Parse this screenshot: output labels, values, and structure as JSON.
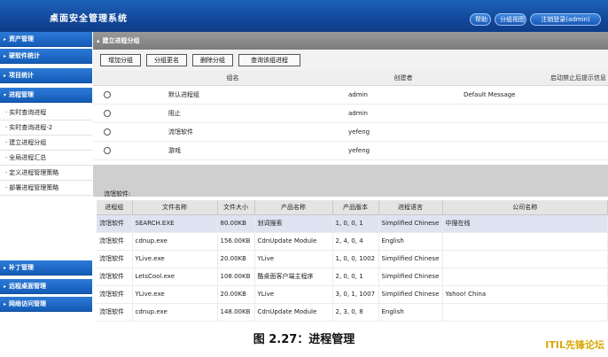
{
  "header": {
    "title": "桌面安全管理系统",
    "buttons": {
      "help": "帮助",
      "group_view": "分组视图",
      "logout": "注销登录(admin)"
    }
  },
  "sidebar": {
    "top_sections": [
      "资产管理",
      "硬软件统计",
      "项目统计",
      "进程管理"
    ],
    "process_items": [
      "实时查询进程",
      "实时查询进程-2",
      "建立进程分组",
      "全局进程汇总",
      "定义进程管理策略",
      "部署进程管理策略"
    ],
    "bottom_sections": [
      "补丁管理",
      "远程桌面管理",
      "网络访问管理"
    ]
  },
  "main": {
    "section_title": "建立进程分组",
    "toolbar": {
      "add": "增加分组",
      "rename": "分组更名",
      "delete": "删除分组",
      "query": "查询该组进程"
    },
    "group_table": {
      "headers": {
        "name": "组名",
        "creator": "创建者",
        "message": "启动禁止后提示信息"
      },
      "rows": [
        {
          "name": "默认进程组",
          "creator": "admin",
          "message": "Default Message"
        },
        {
          "name": "阻止",
          "creator": "admin",
          "message": ""
        },
        {
          "name": "流氓软件",
          "creator": "yefeng",
          "message": ""
        },
        {
          "name": "游戏",
          "creator": "yefeng",
          "message": ""
        }
      ]
    },
    "process_caption": "流氓软件:",
    "process_table": {
      "headers": [
        "进程组",
        "文件名称",
        "文件大小",
        "产品名称",
        "产品版本",
        "进程语言",
        "公司名称"
      ],
      "rows": [
        [
          "流氓软件",
          "SEARCH.EXE",
          "80.00KB",
          "划词搜索",
          "1, 0, 0, 1",
          "Simplified Chinese",
          "中搜在线"
        ],
        [
          "流氓软件",
          "cdnup.exe",
          "156.00KB",
          "CdnUpdate Module",
          "2, 4, 0, 4",
          "English",
          ""
        ],
        [
          "流氓软件",
          "YLive.exe",
          "20.00KB",
          "YLive",
          "1, 0, 0, 1002",
          "Simplified Chinese",
          ""
        ],
        [
          "流氓软件",
          "LetsCool.exe",
          "108.00KB",
          "酷桌面客户端主程序",
          "2, 0, 0, 1",
          "Simplified Chinese",
          ""
        ],
        [
          "流氓软件",
          "YLive.exe",
          "20.00KB",
          "YLive",
          "3, 0, 1, 1007",
          "Simplified Chinese",
          "Yahoo! China"
        ],
        [
          "流氓软件",
          "cdnup.exe",
          "148.00KB",
          "CdnUpdate Module",
          "2, 3, 0, 8",
          "English",
          ""
        ]
      ]
    }
  },
  "figure_caption": "图 2.27：进程管理",
  "watermark": "ITIL先锋论坛"
}
